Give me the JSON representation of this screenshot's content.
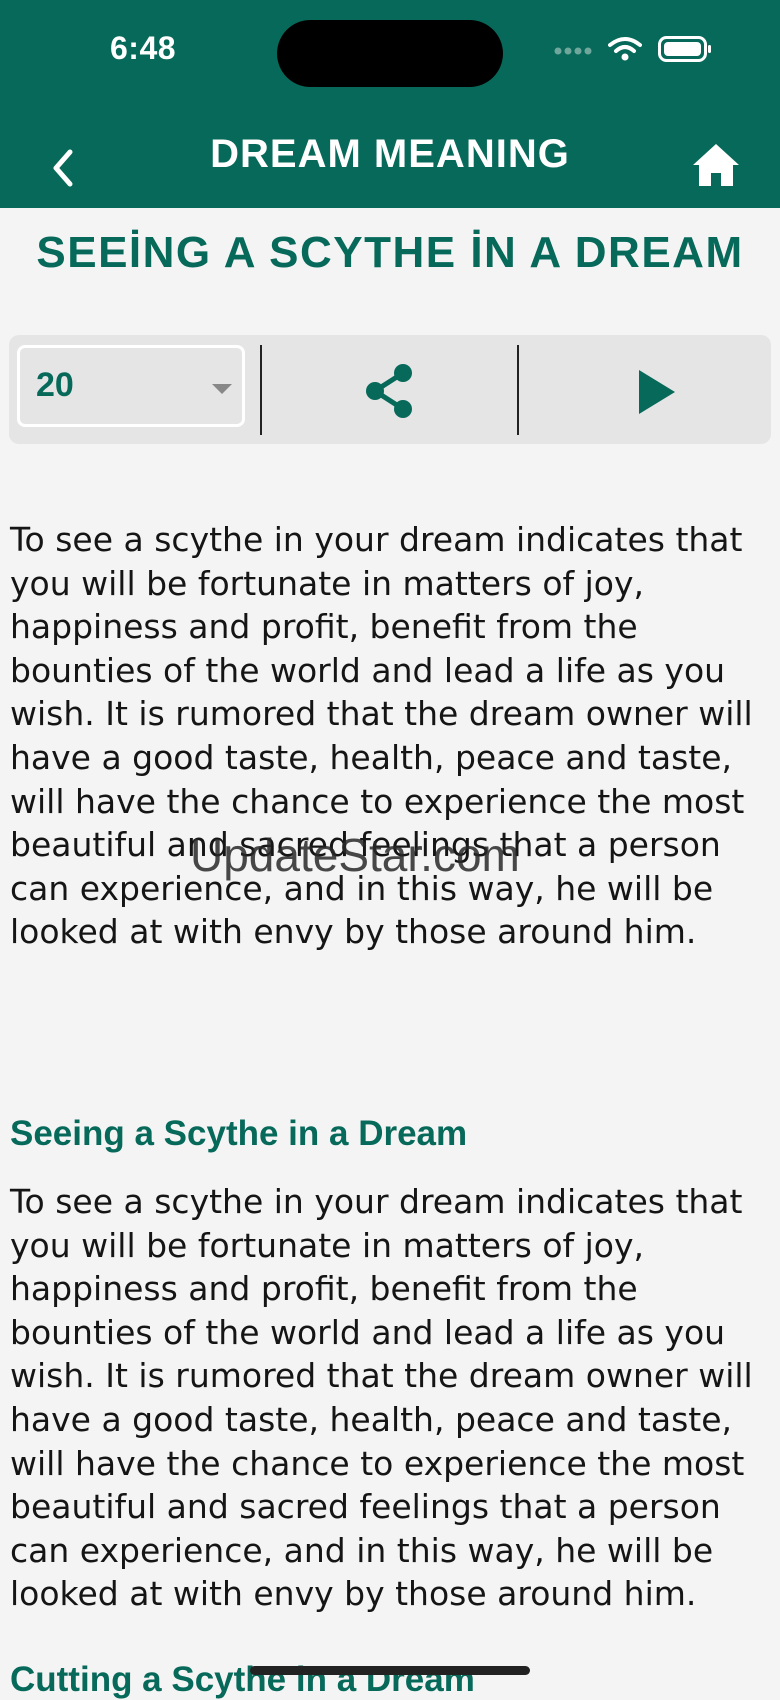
{
  "status_bar": {
    "time": "6:48"
  },
  "nav": {
    "title": "DREAM MEANING"
  },
  "page": {
    "title": "SEEİNG A SCYTHE İN A DREAM"
  },
  "toolbar": {
    "dropdown_value": "20"
  },
  "content": {
    "intro": "To see a scythe in your dream indicates that you will be fortunate in matters of joy, happiness and profit, benefit from the bounties of the world and lead a life as you wish. It is rumored that the dream owner will have a good taste, health, peace and taste, will have the chance to experience the most beautiful and sacred feelings that a person can experience, and in this way, he will be looked at with envy by those around him.",
    "sections": [
      {
        "heading": "Seeing a Scythe in a Dream",
        "text": "To see a scythe in your dream indicates that you will be fortunate in matters of joy, happiness and profit, benefit from the bounties of the world and lead a life as you wish. It is rumored that the dream owner will have a good taste, health, peace and taste, will have the chance to experience the most beautiful and sacred feelings that a person can experience, and in this way, he will be looked at with envy by those around him."
      },
      {
        "heading": "Cutting a Scythe in a Dream"
      }
    ]
  },
  "watermark": "UpdateStar.com",
  "colors": {
    "header": "#07695a",
    "accent": "#07695a",
    "background": "#f4f4f4"
  }
}
